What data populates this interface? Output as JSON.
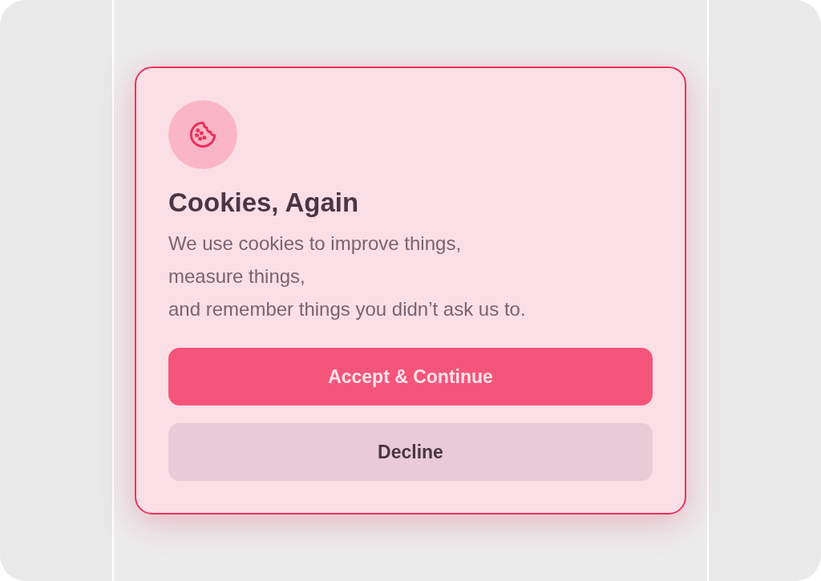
{
  "dialog": {
    "title": "Cookies, Again",
    "message": "We use cookies to improve things,\nmeasure things,\nand remember things you didn’t ask us to.",
    "buttons": [
      {
        "label": "Accept & Continue",
        "kind": "primary"
      },
      {
        "label": "Decline",
        "kind": "secondary"
      }
    ]
  }
}
